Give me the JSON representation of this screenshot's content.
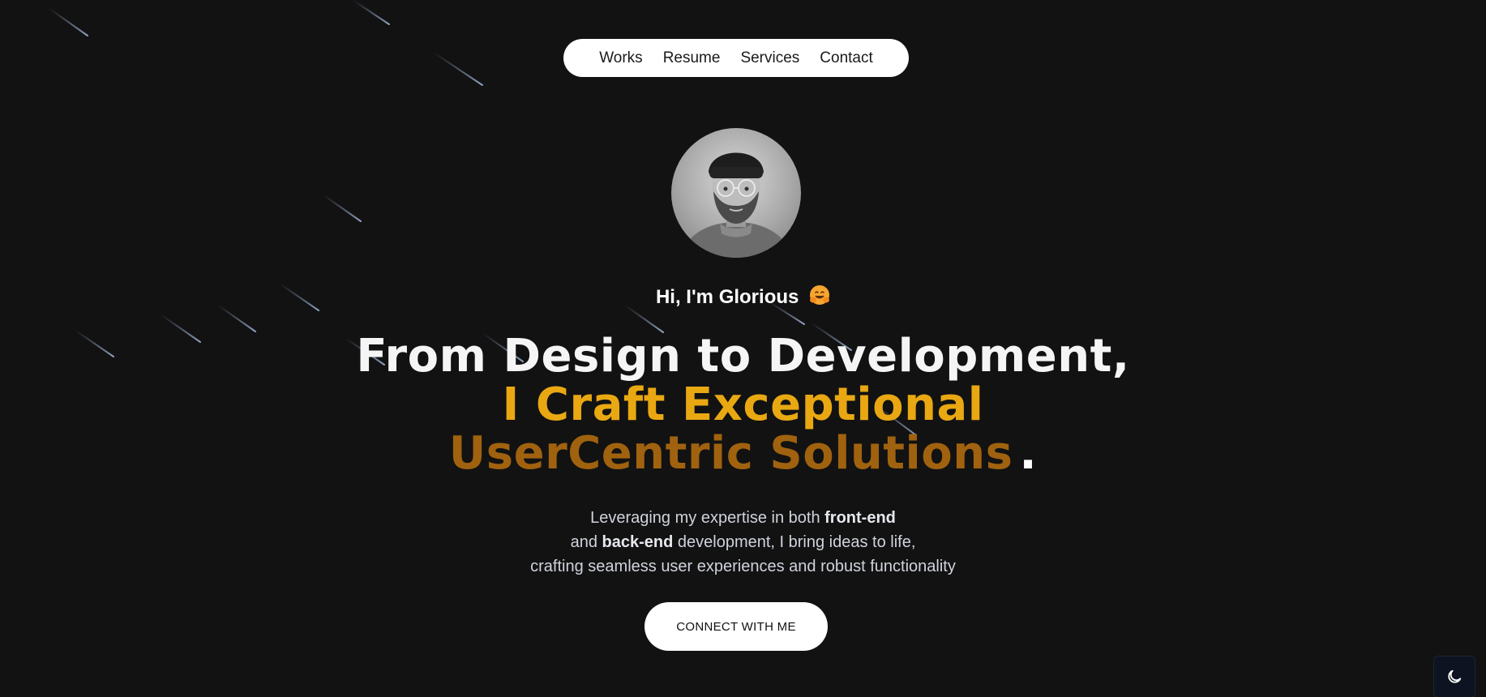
{
  "nav": {
    "items": [
      {
        "label": "Works"
      },
      {
        "label": "Resume"
      },
      {
        "label": "Services"
      },
      {
        "label": "Contact"
      }
    ]
  },
  "hero": {
    "greeting": "Hi, I'm Glorious",
    "greeting_emoji": "🤗",
    "headline": {
      "line1": "From Design to Development,",
      "line2": "I Craft Exceptional",
      "line3": "UserCentric Solutions",
      "punctuation": "."
    },
    "subtext": {
      "p1_a": "Leveraging my expertise in both ",
      "p1_b": "front-end",
      "p2_a": "and ",
      "p2_b": "back-end",
      "p2_c": " development, I bring ideas to life,",
      "p3": "crafting seamless user experiences and robust functionality"
    },
    "cta_label": "CONNECT WITH ME"
  },
  "icons": {
    "theme_toggle": "moon-icon",
    "avatar": "profile-photo"
  },
  "colors": {
    "background": "#121212",
    "headline_white": "#f5f5f5",
    "headline_gold": "#e9a812",
    "headline_bronze": "#a0620f"
  }
}
